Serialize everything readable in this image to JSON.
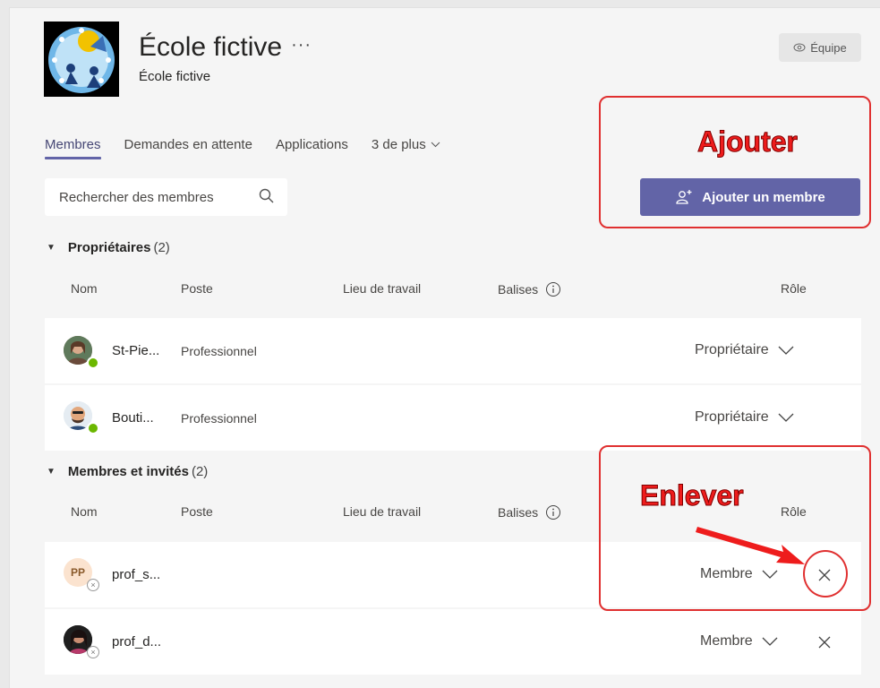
{
  "team": {
    "name": "École fictive",
    "more": "···",
    "subtitle": "École fictive",
    "badge": "Équipe"
  },
  "tabs": [
    {
      "label": "Membres"
    },
    {
      "label": "Demandes en attente"
    },
    {
      "label": "Applications"
    },
    {
      "label": "3 de plus"
    }
  ],
  "search": {
    "placeholder": "Rechercher des membres"
  },
  "add_button": {
    "label": "Ajouter un membre"
  },
  "columns": {
    "nom": "Nom",
    "poste": "Poste",
    "lieu": "Lieu de travail",
    "balises": "Balises",
    "role": "Rôle"
  },
  "owners": {
    "title": "Propriétaires",
    "count": "(2)",
    "rows": [
      {
        "initials": "",
        "name": "St-Pie...",
        "position": "Professionnel",
        "role": "Propriétaire"
      },
      {
        "initials": "",
        "name": "Bouti...",
        "position": "Professionnel",
        "role": "Propriétaire"
      }
    ]
  },
  "members": {
    "title": "Membres et invités",
    "count": "(2)",
    "rows": [
      {
        "initials": "PP",
        "name": "prof_s...",
        "position": "",
        "role": "Membre"
      },
      {
        "initials": "",
        "name": "prof_d...",
        "position": "",
        "role": "Membre"
      }
    ]
  },
  "annotations": {
    "add": "Ajouter",
    "remove": "Enlever"
  },
  "colors": {
    "accent": "#6264a7",
    "annotation": "#ee1c1c",
    "online": "#6bb700"
  }
}
